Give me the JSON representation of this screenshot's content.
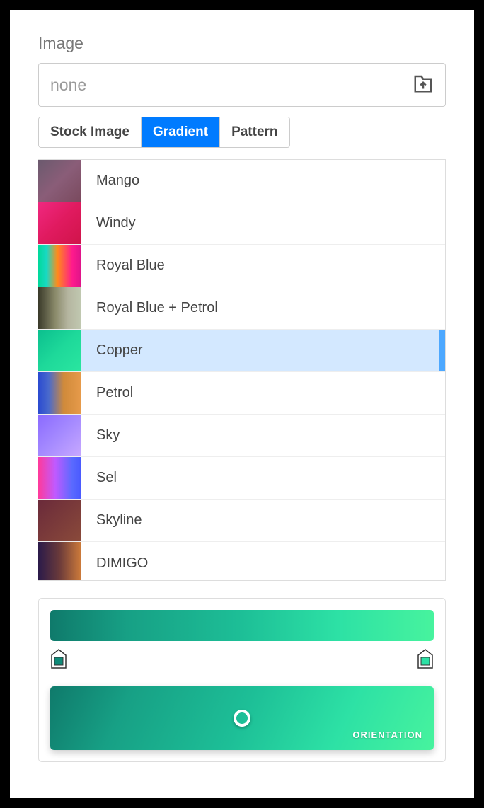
{
  "section": {
    "title": "Image"
  },
  "fileInput": {
    "placeholder": "none"
  },
  "tabs": [
    {
      "label": "Stock Image",
      "active": false
    },
    {
      "label": "Gradient",
      "active": true
    },
    {
      "label": "Pattern",
      "active": false
    }
  ],
  "gradients": [
    {
      "name": "Mango",
      "css": "linear-gradient(135deg,#6b5a6e 0%,#8a5d78 50%,#7a4a5e 100%)",
      "selected": false
    },
    {
      "name": "Windy",
      "css": "linear-gradient(135deg,#f02880 0%,#e01a5f 50%,#d0144a 100%)",
      "selected": false
    },
    {
      "name": "Royal Blue",
      "css": "linear-gradient(90deg,#00d99a 0%,#1ad9c4 20%,#ff8c1a 45%,#ff1a8c 80%,#e0148a 100%)",
      "selected": false
    },
    {
      "name": "Royal Blue + Petrol",
      "css": "linear-gradient(90deg,#3a3a2a 0%,#8a8a6a 40%,#b5b5a0 70%,#c0c8b0 100%)",
      "selected": false
    },
    {
      "name": "Copper",
      "css": "linear-gradient(135deg,#0bbf8e 0%,#1ed99a 50%,#2ae6a0 100%)",
      "selected": true
    },
    {
      "name": "Petrol",
      "css": "linear-gradient(90deg,#2a4ad0 0%,#4a6acc 25%,#d08a3a 60%,#e69a4a 100%)",
      "selected": false
    },
    {
      "name": "Sky",
      "css": "linear-gradient(135deg,#8a6aff 0%,#a58aff 50%,#c7a8ff 100%)",
      "selected": false
    },
    {
      "name": "Sel",
      "css": "linear-gradient(90deg,#ff3a9a 0%,#c05aff 40%,#5a6aff 80%,#4a5aff 100%)",
      "selected": false
    },
    {
      "name": "Skyline",
      "css": "linear-gradient(135deg,#6a2a3a 0%,#7a3a3a 50%,#8a4a3a 100%)",
      "selected": false
    },
    {
      "name": "DIMIGO",
      "css": "linear-gradient(90deg,#2a1a4a 0%,#6a3a3a 50%,#cc7a3a 100%)",
      "selected": false
    }
  ],
  "editor": {
    "stops": [
      {
        "position": 0,
        "color": "#0f8a78"
      },
      {
        "position": 100,
        "color": "#2de1a5"
      }
    ],
    "orientationLabel": "ORIENTATION"
  }
}
